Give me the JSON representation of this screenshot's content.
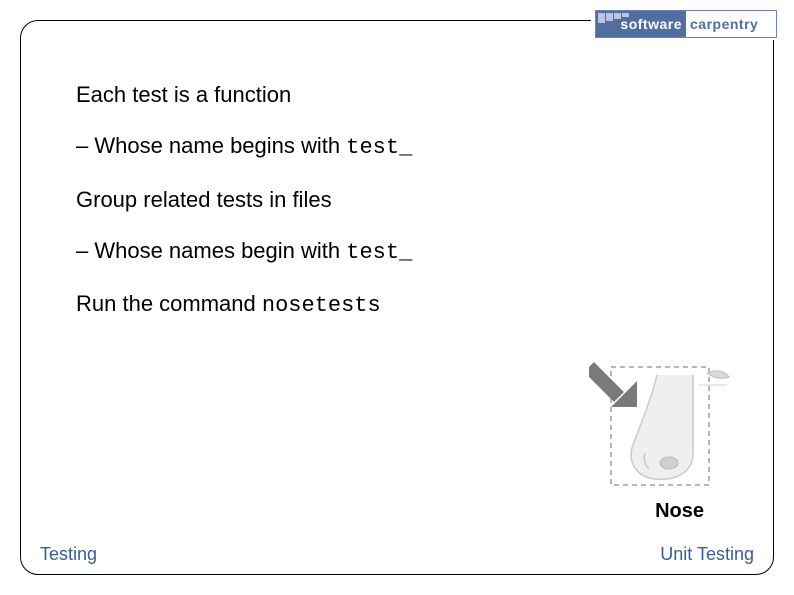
{
  "logo": {
    "left_word": "software",
    "right_word": "carpentry",
    "left_sub": "",
    "right_sub": ""
  },
  "bullets": {
    "b1": "Each test is a function",
    "b2_pre": "– Whose name begins with ",
    "b2_code": "test_",
    "b3": "Group related tests in files",
    "b4_pre": "– Whose names begin with ",
    "b4_code": "test_",
    "b5_pre": "Run the command ",
    "b5_code": "nosetests"
  },
  "figure": {
    "caption": "Nose"
  },
  "footer": {
    "left": "Testing",
    "right": "Unit Testing"
  }
}
